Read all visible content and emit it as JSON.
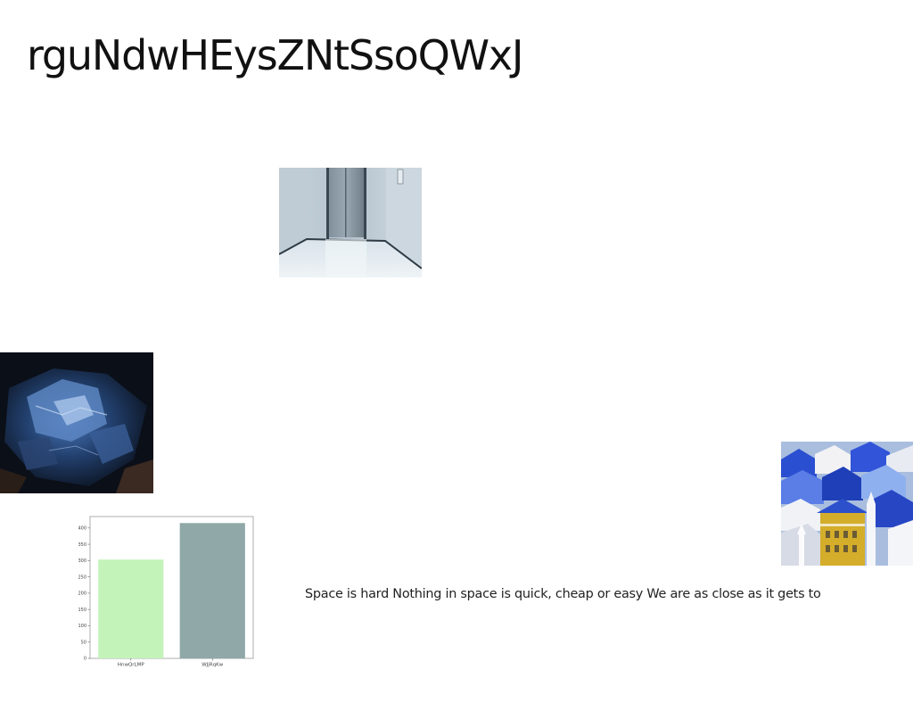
{
  "title": "rguNdwHEysZNtSsoQWxJ",
  "body_text": "Space is hard Nothing in space is quick, cheap or easy We are as close as it gets to",
  "images": [
    {
      "name": "elevator-photo",
      "subject": "elevator lobby"
    },
    {
      "name": "rock-photo",
      "subject": "blue mineral rock"
    },
    {
      "name": "town-photo",
      "subject": "aerial view of blue rooftops"
    }
  ],
  "chart_data": {
    "type": "bar",
    "categories": [
      "HnwQrLMP",
      "WJjRqKw"
    ],
    "values": [
      303,
      415
    ],
    "colors": [
      "#c3f3b9",
      "#90a8a8"
    ],
    "yticks": [
      0,
      50,
      100,
      150,
      200,
      250,
      300,
      350,
      400
    ],
    "ylim": [
      0,
      435
    ],
    "title": "",
    "xlabel": "",
    "ylabel": ""
  }
}
